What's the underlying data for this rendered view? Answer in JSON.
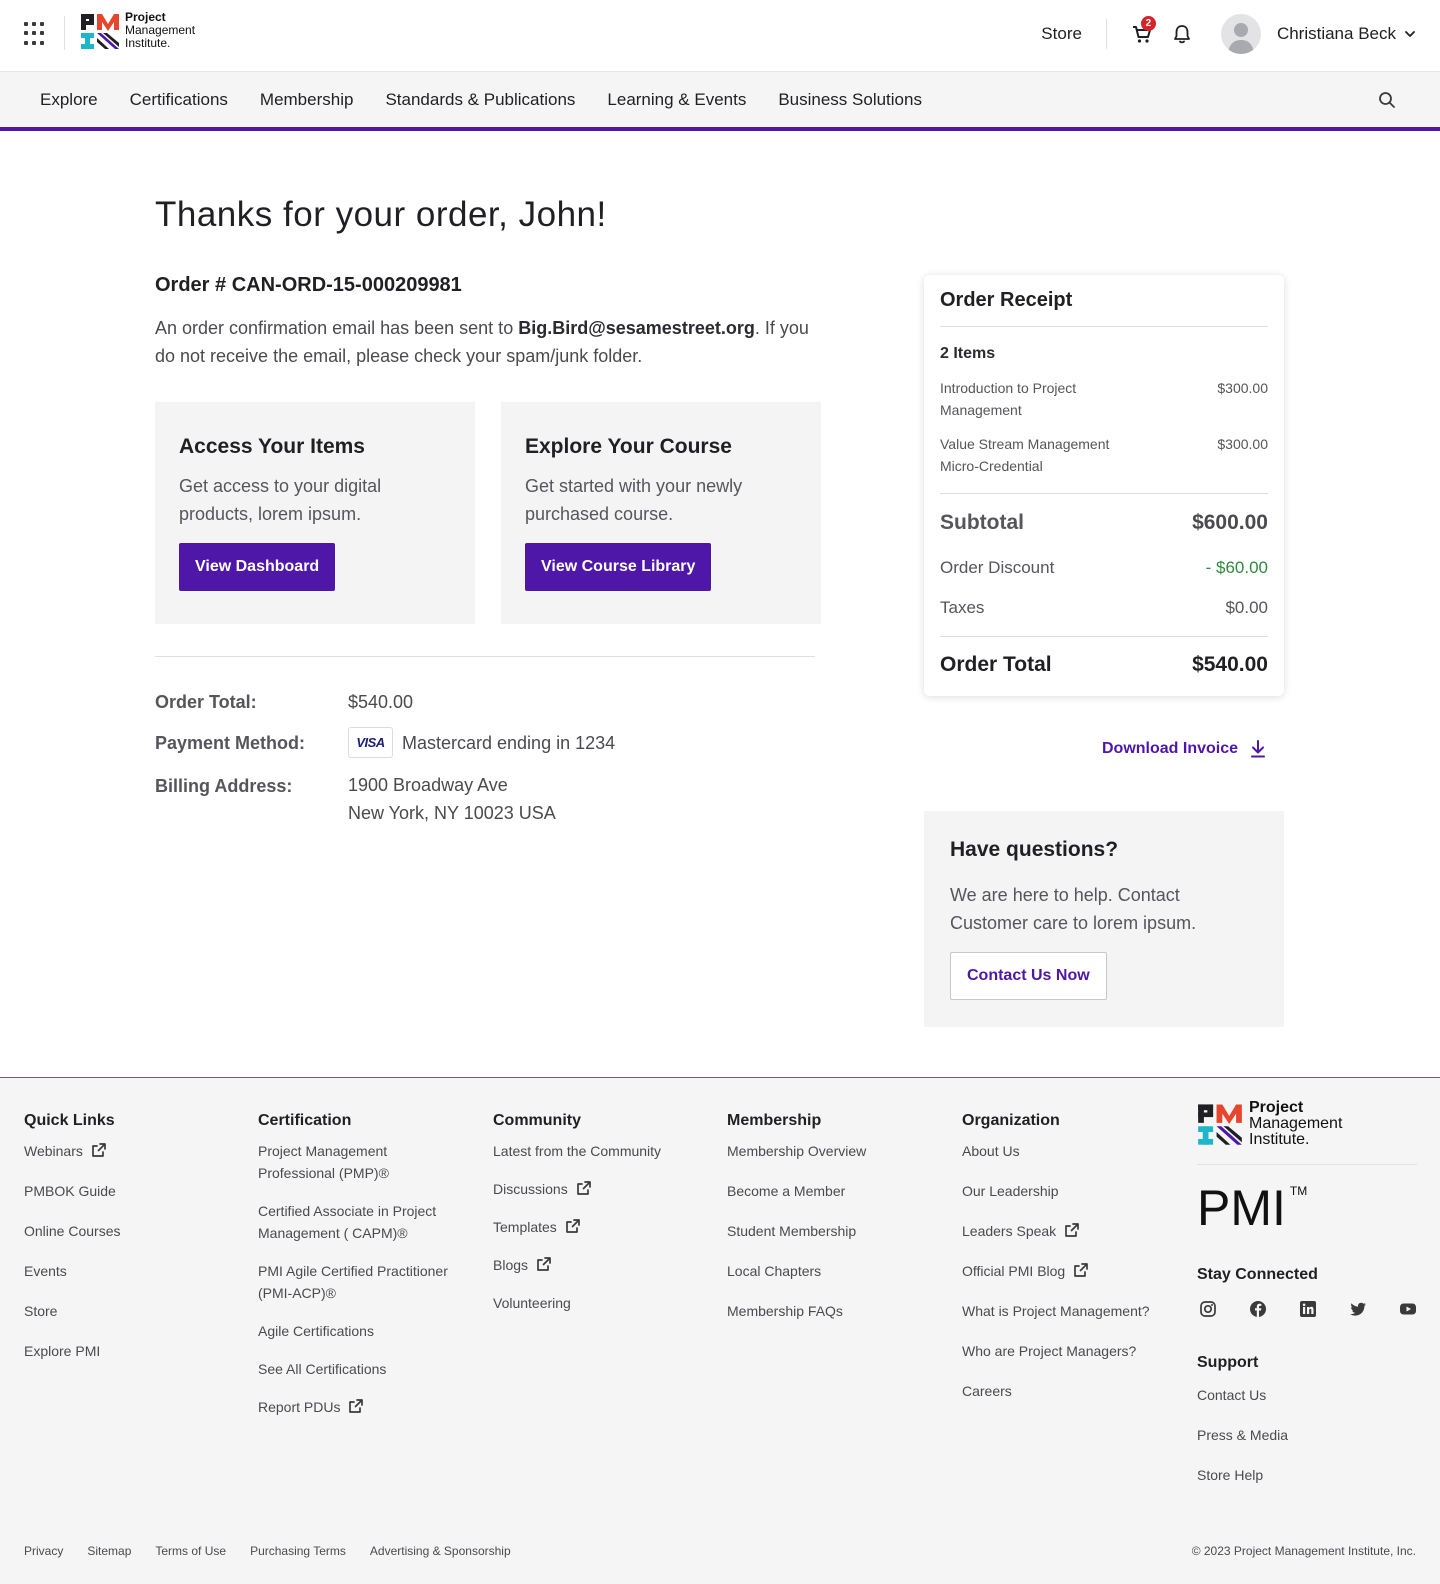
{
  "header": {
    "logo": {
      "line1": "Project",
      "line2": "Management",
      "line3": "Institute."
    },
    "store_label": "Store",
    "cart_count": "2",
    "user_name": "Christiana Beck"
  },
  "nav": {
    "items": [
      "Explore",
      "Certifications",
      "Membership",
      "Standards & Publications",
      "Learning & Events",
      "Business Solutions"
    ]
  },
  "main": {
    "title": "Thanks for your order, John!",
    "order_number": "Order # CAN-ORD-15-000209981",
    "confirm_prefix": "An order confirmation email has been sent to ",
    "confirm_email": "Big.Bird@sesamestreet.org",
    "confirm_suffix": ". If you do not receive the email, please check your spam/junk folder.",
    "cards": [
      {
        "title": "Access Your Items",
        "text": "Get access to your digital products, lorem ipsum.",
        "button": "View Dashboard"
      },
      {
        "title": "Explore Your Course",
        "text": "Get started with your newly purchased course.",
        "button": "View Course Library"
      }
    ],
    "details": {
      "total_label": "Order Total:",
      "total_value": "$540.00",
      "payment_label": "Payment Method:",
      "card_brand": "VISA",
      "payment_value": "Mastercard ending in 1234",
      "billing_label": "Billing Address:",
      "billing_line1": "1900 Broadway Ave",
      "billing_line2": "New York, NY 10023 USA"
    }
  },
  "receipt": {
    "title": "Order Receipt",
    "item_count": "2 Items",
    "items": [
      {
        "name": "Introduction to Project Management",
        "price": "$300.00"
      },
      {
        "name": "Value Stream Management Micro-Credential",
        "price": "$300.00"
      }
    ],
    "subtotal_label": "Subtotal",
    "subtotal_value": "$600.00",
    "discount_label": "Order Discount",
    "discount_value": "- $60.00",
    "taxes_label": "Taxes",
    "taxes_value": "$0.00",
    "total_label": "Order Total",
    "total_value": "$540.00"
  },
  "download_label": "Download Invoice",
  "questions": {
    "title": "Have questions?",
    "text": "We are here to help. Contact Customer care to lorem ipsum.",
    "button": "Contact Us Now"
  },
  "footer": {
    "columns": [
      {
        "title": "Quick Links",
        "links": [
          {
            "label": "Webinars",
            "external": true
          },
          {
            "label": "PMBOK Guide",
            "external": false
          },
          {
            "label": "Online Courses",
            "external": false
          },
          {
            "label": "Events",
            "external": false
          },
          {
            "label": "Store",
            "external": false
          },
          {
            "label": "Explore PMI",
            "external": false
          }
        ]
      },
      {
        "title": "Certification",
        "links": [
          {
            "label": "Project Management Professional (PMP)®",
            "external": false
          },
          {
            "label": "Certified Associate in Project Management ( CAPM)®",
            "external": false
          },
          {
            "label": "PMI Agile Certified Practitioner (PMI-ACP)®",
            "external": false
          },
          {
            "label": "Agile Certifications",
            "external": false
          },
          {
            "label": "See All Certifications",
            "external": false
          },
          {
            "label": "Report PDUs",
            "external": true
          }
        ]
      },
      {
        "title": "Community",
        "links": [
          {
            "label": "Latest from the Community",
            "external": false
          },
          {
            "label": "Discussions",
            "external": true
          },
          {
            "label": "Templates",
            "external": true
          },
          {
            "label": "Blogs",
            "external": true
          },
          {
            "label": "Volunteering",
            "external": false
          }
        ]
      },
      {
        "title": "Membership",
        "links": [
          {
            "label": "Membership Overview",
            "external": false
          },
          {
            "label": "Become a Member",
            "external": false
          },
          {
            "label": "Student Membership",
            "external": false
          },
          {
            "label": "Local Chapters",
            "external": false
          },
          {
            "label": "Membership FAQs",
            "external": false
          }
        ]
      },
      {
        "title": "Organization",
        "links": [
          {
            "label": "About Us",
            "external": false
          },
          {
            "label": "Our Leadership",
            "external": false
          },
          {
            "label": "Leaders Speak",
            "external": true
          },
          {
            "label": "Official PMI Blog",
            "external": true
          },
          {
            "label": "What is Project Management?",
            "external": false
          },
          {
            "label": "Who are Project Managers?",
            "external": false
          },
          {
            "label": "Careers",
            "external": false
          }
        ]
      }
    ],
    "logo": {
      "line1": "Project",
      "line2": "Management",
      "line3": "Institute."
    },
    "pmi_mark": "PMI",
    "tm": "TM",
    "stay_connected": "Stay Connected",
    "socials": [
      "instagram-icon",
      "facebook-icon",
      "linkedin-icon",
      "twitter-icon",
      "youtube-icon"
    ],
    "support_title": "Support",
    "support_links": [
      "Contact Us",
      "Press & Media",
      "Store Help"
    ],
    "legal": [
      "Privacy",
      "Sitemap",
      "Terms of Use",
      "Purchasing Terms",
      "Advertising & Sponsorship"
    ],
    "copyright": "© 2023 Project Management Institute, Inc."
  },
  "colors": {
    "accent": "#4f17a8",
    "discount": "#2e8a3e",
    "badge": "#d8232a"
  }
}
